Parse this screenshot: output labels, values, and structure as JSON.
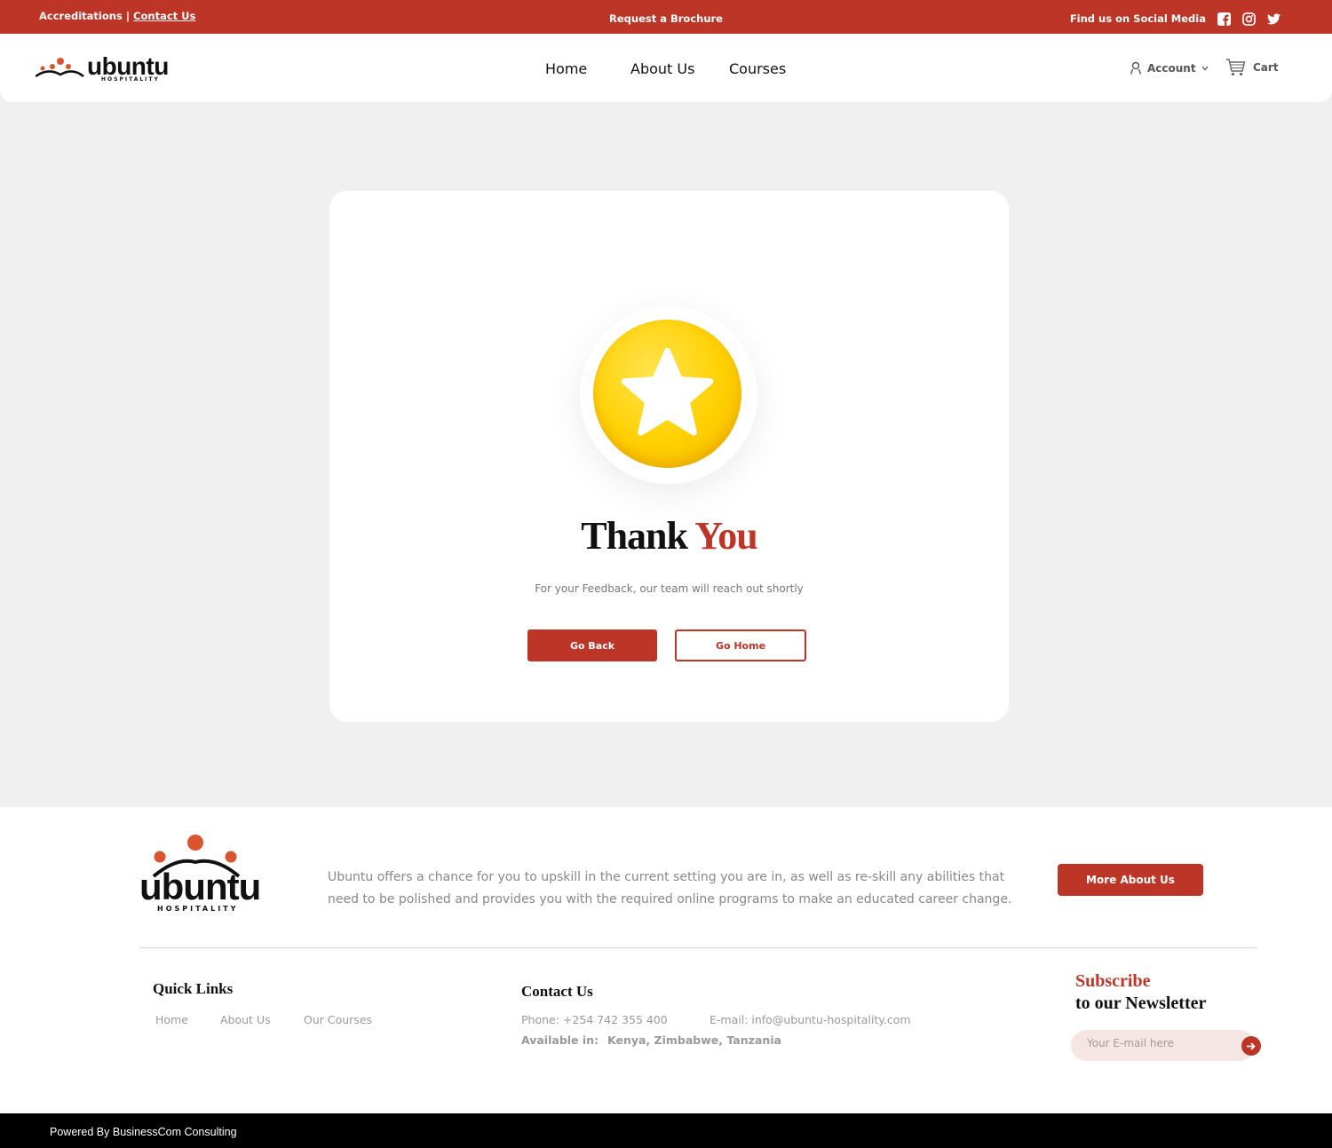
{
  "topbar": {
    "accreditations": "Accreditations",
    "separator": "|",
    "contact": "Contact Us",
    "brochure": "Request a Brochure",
    "social_label": "Find us on Social Media",
    "social_icons": [
      "facebook-icon",
      "instagram-icon",
      "twitter-icon"
    ]
  },
  "header": {
    "logo_word": "ubuntu",
    "logo_sub": "HOSPITALITY",
    "nav": [
      "Home",
      "About Us",
      "Courses"
    ],
    "account": "Account",
    "cart": "Cart"
  },
  "card": {
    "title_a": "Thank",
    "title_b": "You",
    "subtitle": "For your Feedback, our team will reach out shortly",
    "go_back": "Go Back",
    "go_home": "Go Home"
  },
  "footer": {
    "logo_word": "ubuntu",
    "logo_sub": "HOSPITALITY",
    "description": "Ubuntu offers a chance for you to upskill in the current setting you are in, as well as re-skill any abilities that need to be polished and provides you with the required online programs to make an educated career change.",
    "more_button": "More About Us",
    "quick_links_title": "Quick Links",
    "quick_links": [
      "Home",
      "About Us",
      "Our Courses"
    ],
    "contact_title": "Contact Us",
    "phone": "Phone: +254 742 355 400",
    "email": "E-mail: info@ubuntu-hospitality.com",
    "available_label": "Available in:",
    "available_value": "Kenya, Zimbabwe, Tanzania",
    "subscribe_1": "Subscribe",
    "subscribe_2": "to our Newsletter",
    "email_placeholder": "Your E-mail here"
  },
  "bottombar": {
    "powered": "Powered By BusinessCom Consulting"
  },
  "colors": {
    "brand": "#bd3526",
    "gold": "#ffd000",
    "bottombar": "#000000"
  }
}
